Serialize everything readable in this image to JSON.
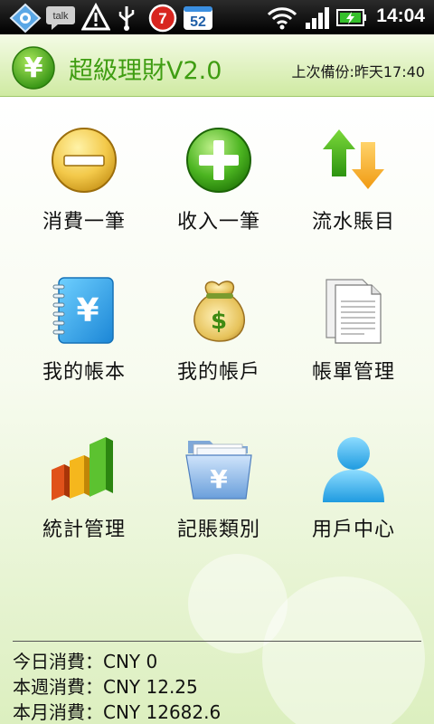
{
  "status_bar": {
    "icons": [
      "network-diamond-icon",
      "talk-icon",
      "warning-icon",
      "usb-icon",
      "alarm-icon",
      "calendar-icon",
      "wifi-icon",
      "signal-icon",
      "battery-icon"
    ],
    "talk_text": "talk",
    "alarm_badge": "7",
    "calendar_badge": "52",
    "time": "14:04"
  },
  "header": {
    "app_title": "超級理財V2.0",
    "backup_info": "上次備份:昨天17:40",
    "logo_glyph": "¥",
    "accent": "#3f9d12"
  },
  "grid": [
    {
      "label": "消費一筆",
      "icon": "minus-circle-icon"
    },
    {
      "label": "收入一筆",
      "icon": "plus-circle-icon"
    },
    {
      "label": "流水賬目",
      "icon": "transfer-arrows-icon"
    },
    {
      "label": "我的帳本",
      "icon": "ledger-book-icon"
    },
    {
      "label": "我的帳戶",
      "icon": "money-bag-icon"
    },
    {
      "label": "帳單管理",
      "icon": "documents-icon"
    },
    {
      "label": "統計管理",
      "icon": "bar-chart-icon"
    },
    {
      "label": "記賬類別",
      "icon": "folder-icon"
    },
    {
      "label": "用戶中心",
      "icon": "user-icon"
    }
  ],
  "icon_glyphs": {
    "yen": "¥",
    "dollar": "$"
  },
  "summary": {
    "today": "今日消費：CNY 0",
    "week": "本週消費：CNY 12.25",
    "month": "本月消費：CNY 12682.6"
  }
}
